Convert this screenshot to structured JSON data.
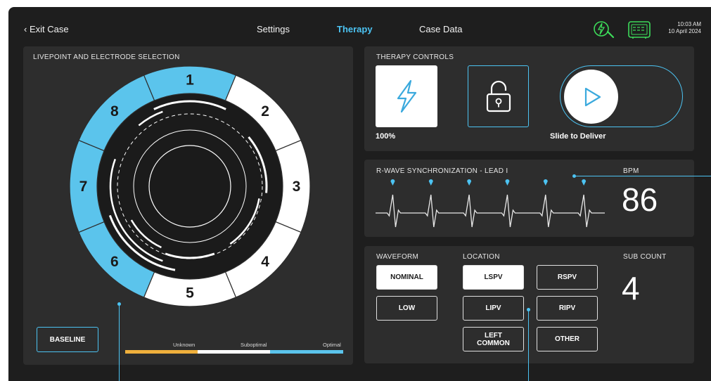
{
  "nav": {
    "exit_label": "Exit Case",
    "tabs": [
      {
        "label": "Settings",
        "active": false
      },
      {
        "label": "Therapy",
        "active": true
      },
      {
        "label": "Case Data",
        "active": false
      }
    ],
    "time": "10:03 AM",
    "date": "10 April 2024",
    "status_icons": [
      "pulse-sensor-icon",
      "monitor-icon"
    ]
  },
  "livepoint": {
    "title": "LIVEPOINT AND ELECTRODE SELECTION",
    "segments": [
      {
        "label": "1",
        "status": "Optimal"
      },
      {
        "label": "2",
        "status": "Suboptimal"
      },
      {
        "label": "3",
        "status": "Suboptimal"
      },
      {
        "label": "4",
        "status": "Suboptimal"
      },
      {
        "label": "5",
        "status": "Suboptimal"
      },
      {
        "label": "6",
        "status": "Optimal"
      },
      {
        "label": "7",
        "status": "Optimal"
      },
      {
        "label": "8",
        "status": "Optimal"
      }
    ],
    "baseline_label": "BASELINE",
    "legend": [
      {
        "label": "Unknown",
        "color": "#f0b03c"
      },
      {
        "label": "Suboptimal",
        "color": "#ffffff"
      },
      {
        "label": "Optimal",
        "color": "#5bc4ec"
      }
    ]
  },
  "therapy": {
    "title": "THERAPY CONTROLS",
    "energy_icon": "lightning-icon",
    "energy_pct": "100%",
    "lock_icon": "unlock-icon",
    "play_icon": "play-icon",
    "slide_label": "Slide to Deliver"
  },
  "rwave": {
    "title": "R-WAVE SYNCHRONIZATION - LEAD I",
    "bpm_label": "BPM",
    "bpm_value": "86",
    "beats": 6
  },
  "waveform": {
    "title": "WAVEFORM",
    "options": [
      {
        "label": "NOMINAL",
        "selected": true
      },
      {
        "label": "LOW",
        "selected": false
      }
    ]
  },
  "location": {
    "title": "LOCATION",
    "options": [
      {
        "label": "LSPV",
        "selected": true
      },
      {
        "label": "RSPV",
        "selected": false
      },
      {
        "label": "LIPV",
        "selected": false
      },
      {
        "label": "RIPV",
        "selected": false
      },
      {
        "label": "LEFT\nCOMMON",
        "selected": false
      },
      {
        "label": "OTHER",
        "selected": false
      }
    ]
  },
  "sub_count": {
    "title": "SUB COUNT",
    "value": "4"
  },
  "colors": {
    "accent": "#4cc3f2",
    "optimal": "#5bc4ec",
    "suboptimal": "#ffffff",
    "unknown": "#f0b03c",
    "panel": "#2d2d2d",
    "background": "#1e1e1e"
  }
}
